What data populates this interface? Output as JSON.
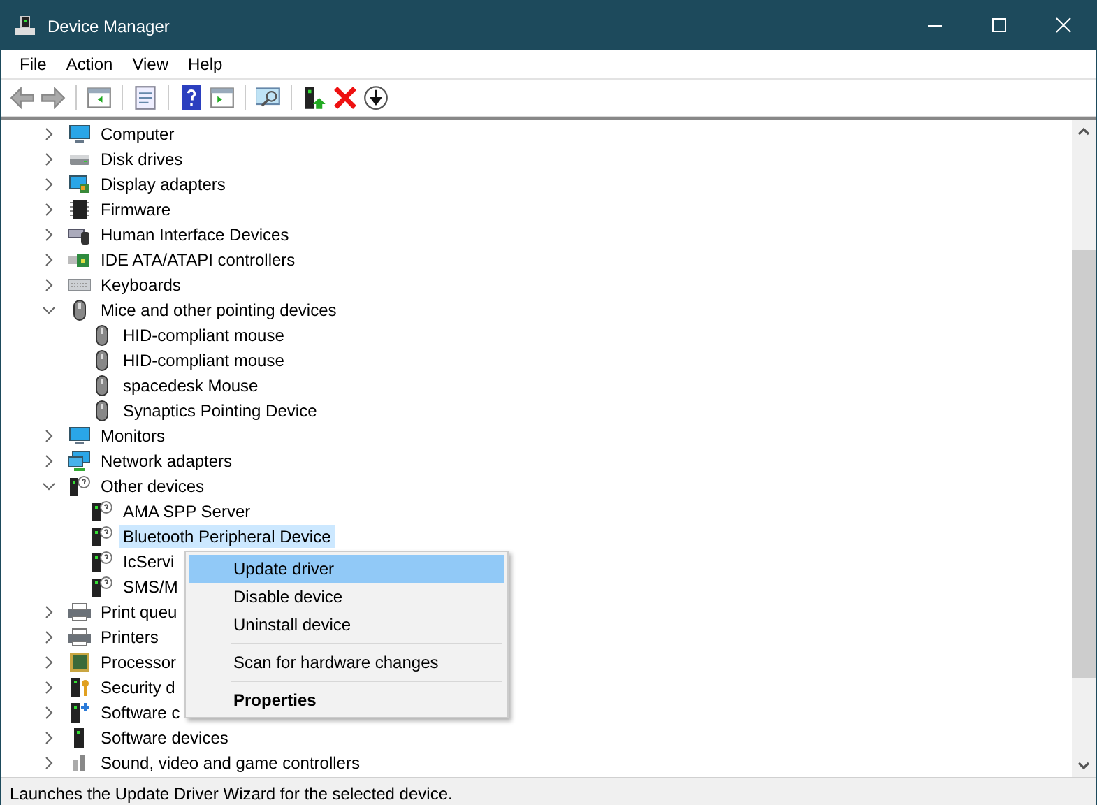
{
  "window": {
    "title": "Device Manager"
  },
  "menu_bar": [
    "File",
    "Action",
    "View",
    "Help"
  ],
  "tree": [
    {
      "label": "Computer",
      "expanded": false
    },
    {
      "label": "Disk drives",
      "expanded": false
    },
    {
      "label": "Display adapters",
      "expanded": false
    },
    {
      "label": "Firmware",
      "expanded": false
    },
    {
      "label": "Human Interface Devices",
      "expanded": false
    },
    {
      "label": "IDE ATA/ATAPI controllers",
      "expanded": false
    },
    {
      "label": "Keyboards",
      "expanded": false
    },
    {
      "label": "Mice and other pointing devices",
      "expanded": true,
      "children": [
        {
          "label": "HID-compliant mouse",
          "selected": false
        },
        {
          "label": "HID-compliant mouse",
          "selected": false
        },
        {
          "label": "spacedesk Mouse",
          "selected": false
        },
        {
          "label": "Synaptics Pointing Device",
          "selected": false
        }
      ]
    },
    {
      "label": "Monitors",
      "expanded": false
    },
    {
      "label": "Network adapters",
      "expanded": false
    },
    {
      "label": "Other devices",
      "expanded": true,
      "children": [
        {
          "label": "AMA SPP Server",
          "selected": false
        },
        {
          "label": "Bluetooth Peripheral Device",
          "selected": true
        },
        {
          "label": "IcServi",
          "selected": false
        },
        {
          "label": "SMS/M",
          "selected": false
        }
      ]
    },
    {
      "label": "Print queu",
      "expanded": false
    },
    {
      "label": "Printers",
      "expanded": false
    },
    {
      "label": "Processor",
      "expanded": false
    },
    {
      "label": "Security d",
      "expanded": false
    },
    {
      "label": "Software c",
      "expanded": false
    },
    {
      "label": "Software devices",
      "expanded": false
    },
    {
      "label": "Sound, video and game controllers",
      "expanded": false
    }
  ],
  "context_menu": [
    [
      {
        "label": "Update driver",
        "highlighted": true,
        "default": false
      },
      {
        "label": "Disable device",
        "highlighted": false,
        "default": false
      },
      {
        "label": "Uninstall device",
        "highlighted": false,
        "default": false
      }
    ],
    [
      {
        "label": "Scan for hardware changes",
        "highlighted": false,
        "default": false
      }
    ],
    [
      {
        "label": "Properties",
        "highlighted": false,
        "default": true
      }
    ]
  ],
  "status_bar": "Launches the Update Driver Wizard for the selected device."
}
